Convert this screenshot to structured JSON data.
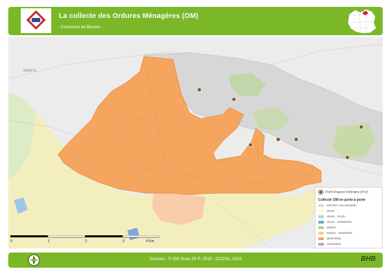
{
  "header": {
    "title": "La collecte des Ordures Ménagères (OM)",
    "subtitle": "- Commune de Bicoule -"
  },
  "map": {
    "place_labels": [
      "BANTIS"
    ],
    "scale_ticks": [
      "0",
      "1",
      "2",
      "3",
      "4 Km"
    ],
    "colors": {
      "collection_zone": "#f5a55e",
      "other_commune": "#d7d7d7",
      "agricultural": "#f3eebe",
      "green_zone": "#c5dba0"
    }
  },
  "legend": {
    "poi_label": "Point d'Apport Volontaire (PAV)",
    "heading": "Collecte OM en porte à porte",
    "items": [
      {
        "label": "APPORT VOLONTAIRE",
        "color": "#d9d9d9"
      },
      {
        "label": "JEUDI",
        "color": "#ffffb8"
      },
      {
        "label": "JEUDI - JEUDI",
        "color": "#a9d8ef"
      },
      {
        "label": "JEUDI - VENDREDI",
        "color": "#6fa8c7"
      },
      {
        "label": "MARDI",
        "color": "#a9d38e"
      },
      {
        "label": "MARDI - VENDREDI",
        "color": "#f8c7a8"
      },
      {
        "label": "MERCREDI",
        "color": "#f5a55e"
      },
      {
        "label": "VENDREDI",
        "color": "#c39ad6"
      }
    ]
  },
  "footer": {
    "sources": "Sources : © IGN Scan 25 ®, 2010 ; CCOVA, 2019",
    "brand": "BHB"
  }
}
